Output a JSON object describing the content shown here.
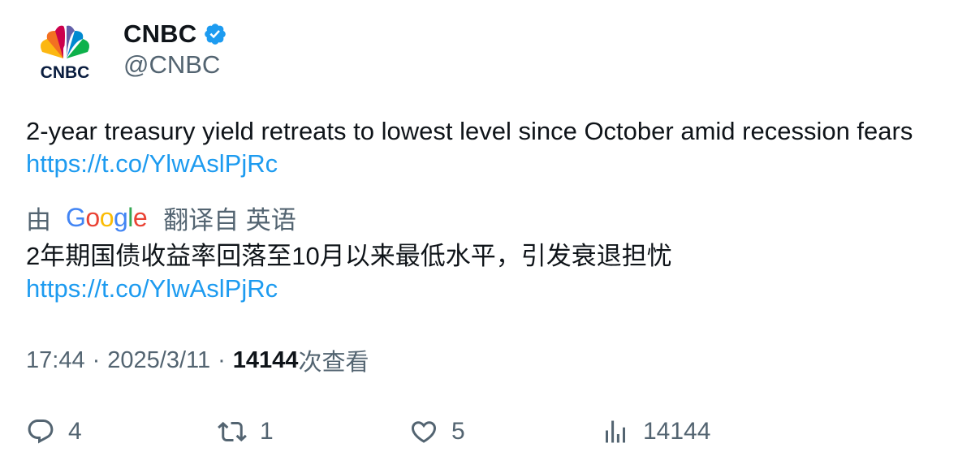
{
  "author": {
    "display_name": "CNBC",
    "handle": "@CNBC",
    "avatar_logo_text": "CNBC",
    "verified": true
  },
  "tweet": {
    "text": "2-year treasury yield retreats to lowest level since October amid recession fears",
    "link": "https://t.co/YlwAslPjRc"
  },
  "translation": {
    "prefix": "由",
    "provider": "Google",
    "suffix": "翻译自 英语",
    "text": "2年期国债收益率回落至10月以来最低水平，引发衰退担忧",
    "link": "https://t.co/YlwAslPjRc"
  },
  "meta": {
    "time": "17:44",
    "separator": "·",
    "date": "2025/3/11",
    "views_count": "14144",
    "views_label": "次查看"
  },
  "actions": {
    "replies": "4",
    "retweets": "1",
    "likes": "5",
    "views": "14144"
  },
  "colors": {
    "link": "#1d9bf0",
    "secondary_text": "#536471",
    "verified_badge": "#1d9bf0"
  },
  "icons": [
    "verified-badge-icon",
    "reply-icon",
    "retweet-icon",
    "like-icon",
    "views-icon",
    "cnbc-peacock-logo"
  ]
}
